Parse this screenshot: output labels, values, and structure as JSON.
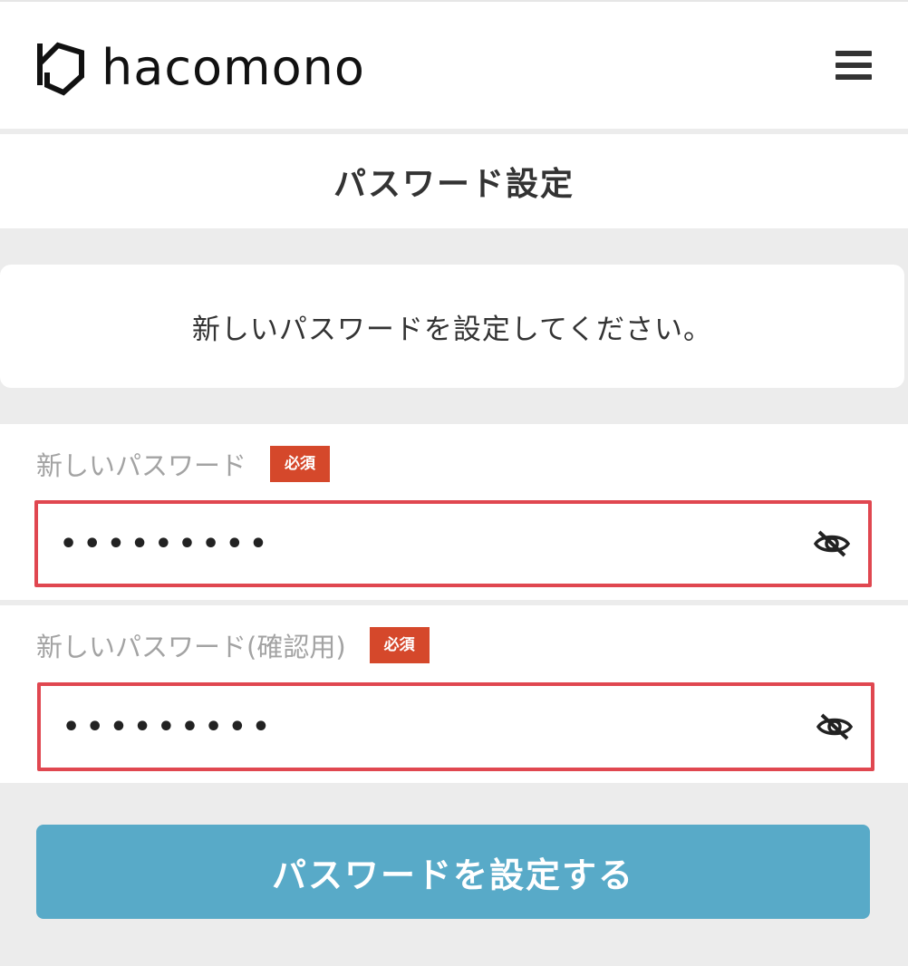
{
  "header": {
    "logo_text": "hacomono",
    "menu_icon": "hamburger-menu-icon"
  },
  "page": {
    "title": "パスワード設定",
    "message": "新しいパスワードを設定してください。"
  },
  "fields": [
    {
      "label": "新しいパスワード",
      "badge": "必須",
      "value": "•••••••••",
      "icon": "eye-slash-icon"
    },
    {
      "label": "新しいパスワード(確認用)",
      "badge": "必須",
      "value": "•••••••••",
      "icon": "eye-slash-icon"
    }
  ],
  "submit": {
    "label": "パスワードを設定する"
  },
  "colors": {
    "badge": "#d5482b",
    "highlight_border": "#e04750",
    "button": "#58aac8",
    "background": "#ececec"
  }
}
